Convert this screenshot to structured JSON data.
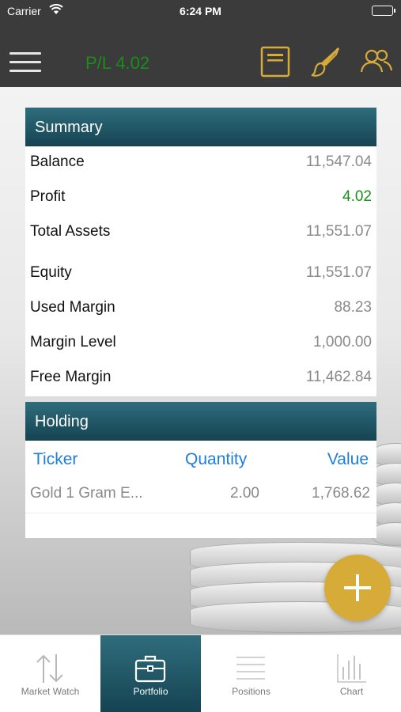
{
  "status_bar": {
    "carrier": "Carrier",
    "time": "6:24 PM"
  },
  "nav": {
    "pl": "P/L 4.02",
    "icons": [
      "menu-icon",
      "report-icon",
      "brush-icon",
      "users-icon"
    ],
    "accent_color": "#d7ab37",
    "pl_color": "#1a8d1a"
  },
  "summary": {
    "title": "Summary",
    "rows": [
      {
        "label": "Balance",
        "value": "11,547.04"
      },
      {
        "label": "Profit",
        "value": "4.02"
      },
      {
        "label": "Total Assets",
        "value": "11,551.07"
      },
      {
        "label": "Equity",
        "value": "11,551.07"
      },
      {
        "label": "Used Margin",
        "value": "88.23"
      },
      {
        "label": "Margin Level",
        "value": "1,000.00"
      },
      {
        "label": "Free Margin",
        "value": "11,462.84"
      }
    ]
  },
  "holding": {
    "title": "Holding",
    "columns": [
      "Ticker",
      "Quantity",
      "Value"
    ],
    "rows": [
      {
        "ticker": "Gold 1 Gram E...",
        "quantity": "2.00",
        "value": "1,768.62"
      }
    ]
  },
  "fab": {
    "icon": "plus-icon"
  },
  "tabs": [
    {
      "label": "Market Watch",
      "icon": "updown-arrows-icon"
    },
    {
      "label": "Portfolio",
      "icon": "briefcase-icon",
      "active": true
    },
    {
      "label": "Positions",
      "icon": "list-icon"
    },
    {
      "label": "Chart",
      "icon": "bar-chart-icon"
    }
  ],
  "header_color": "#1f5566"
}
